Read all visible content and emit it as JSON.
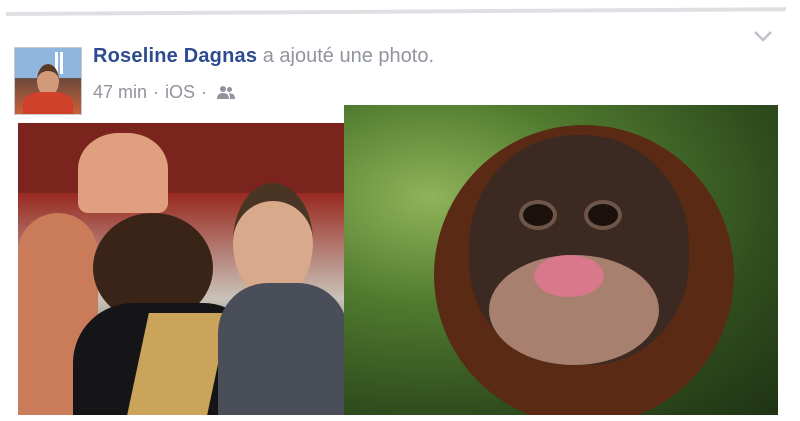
{
  "post": {
    "author": "Roseline Dagnas",
    "action": "a ajouté une photo.",
    "time": "47 min",
    "separator": "·",
    "platform": "iOS",
    "audience_icon": "friends-icon",
    "menu_icon": "chevron-down-icon"
  },
  "colors": {
    "author_link": "#2d4b8e",
    "meta_text": "#90949c",
    "border": "#dddfe2"
  }
}
